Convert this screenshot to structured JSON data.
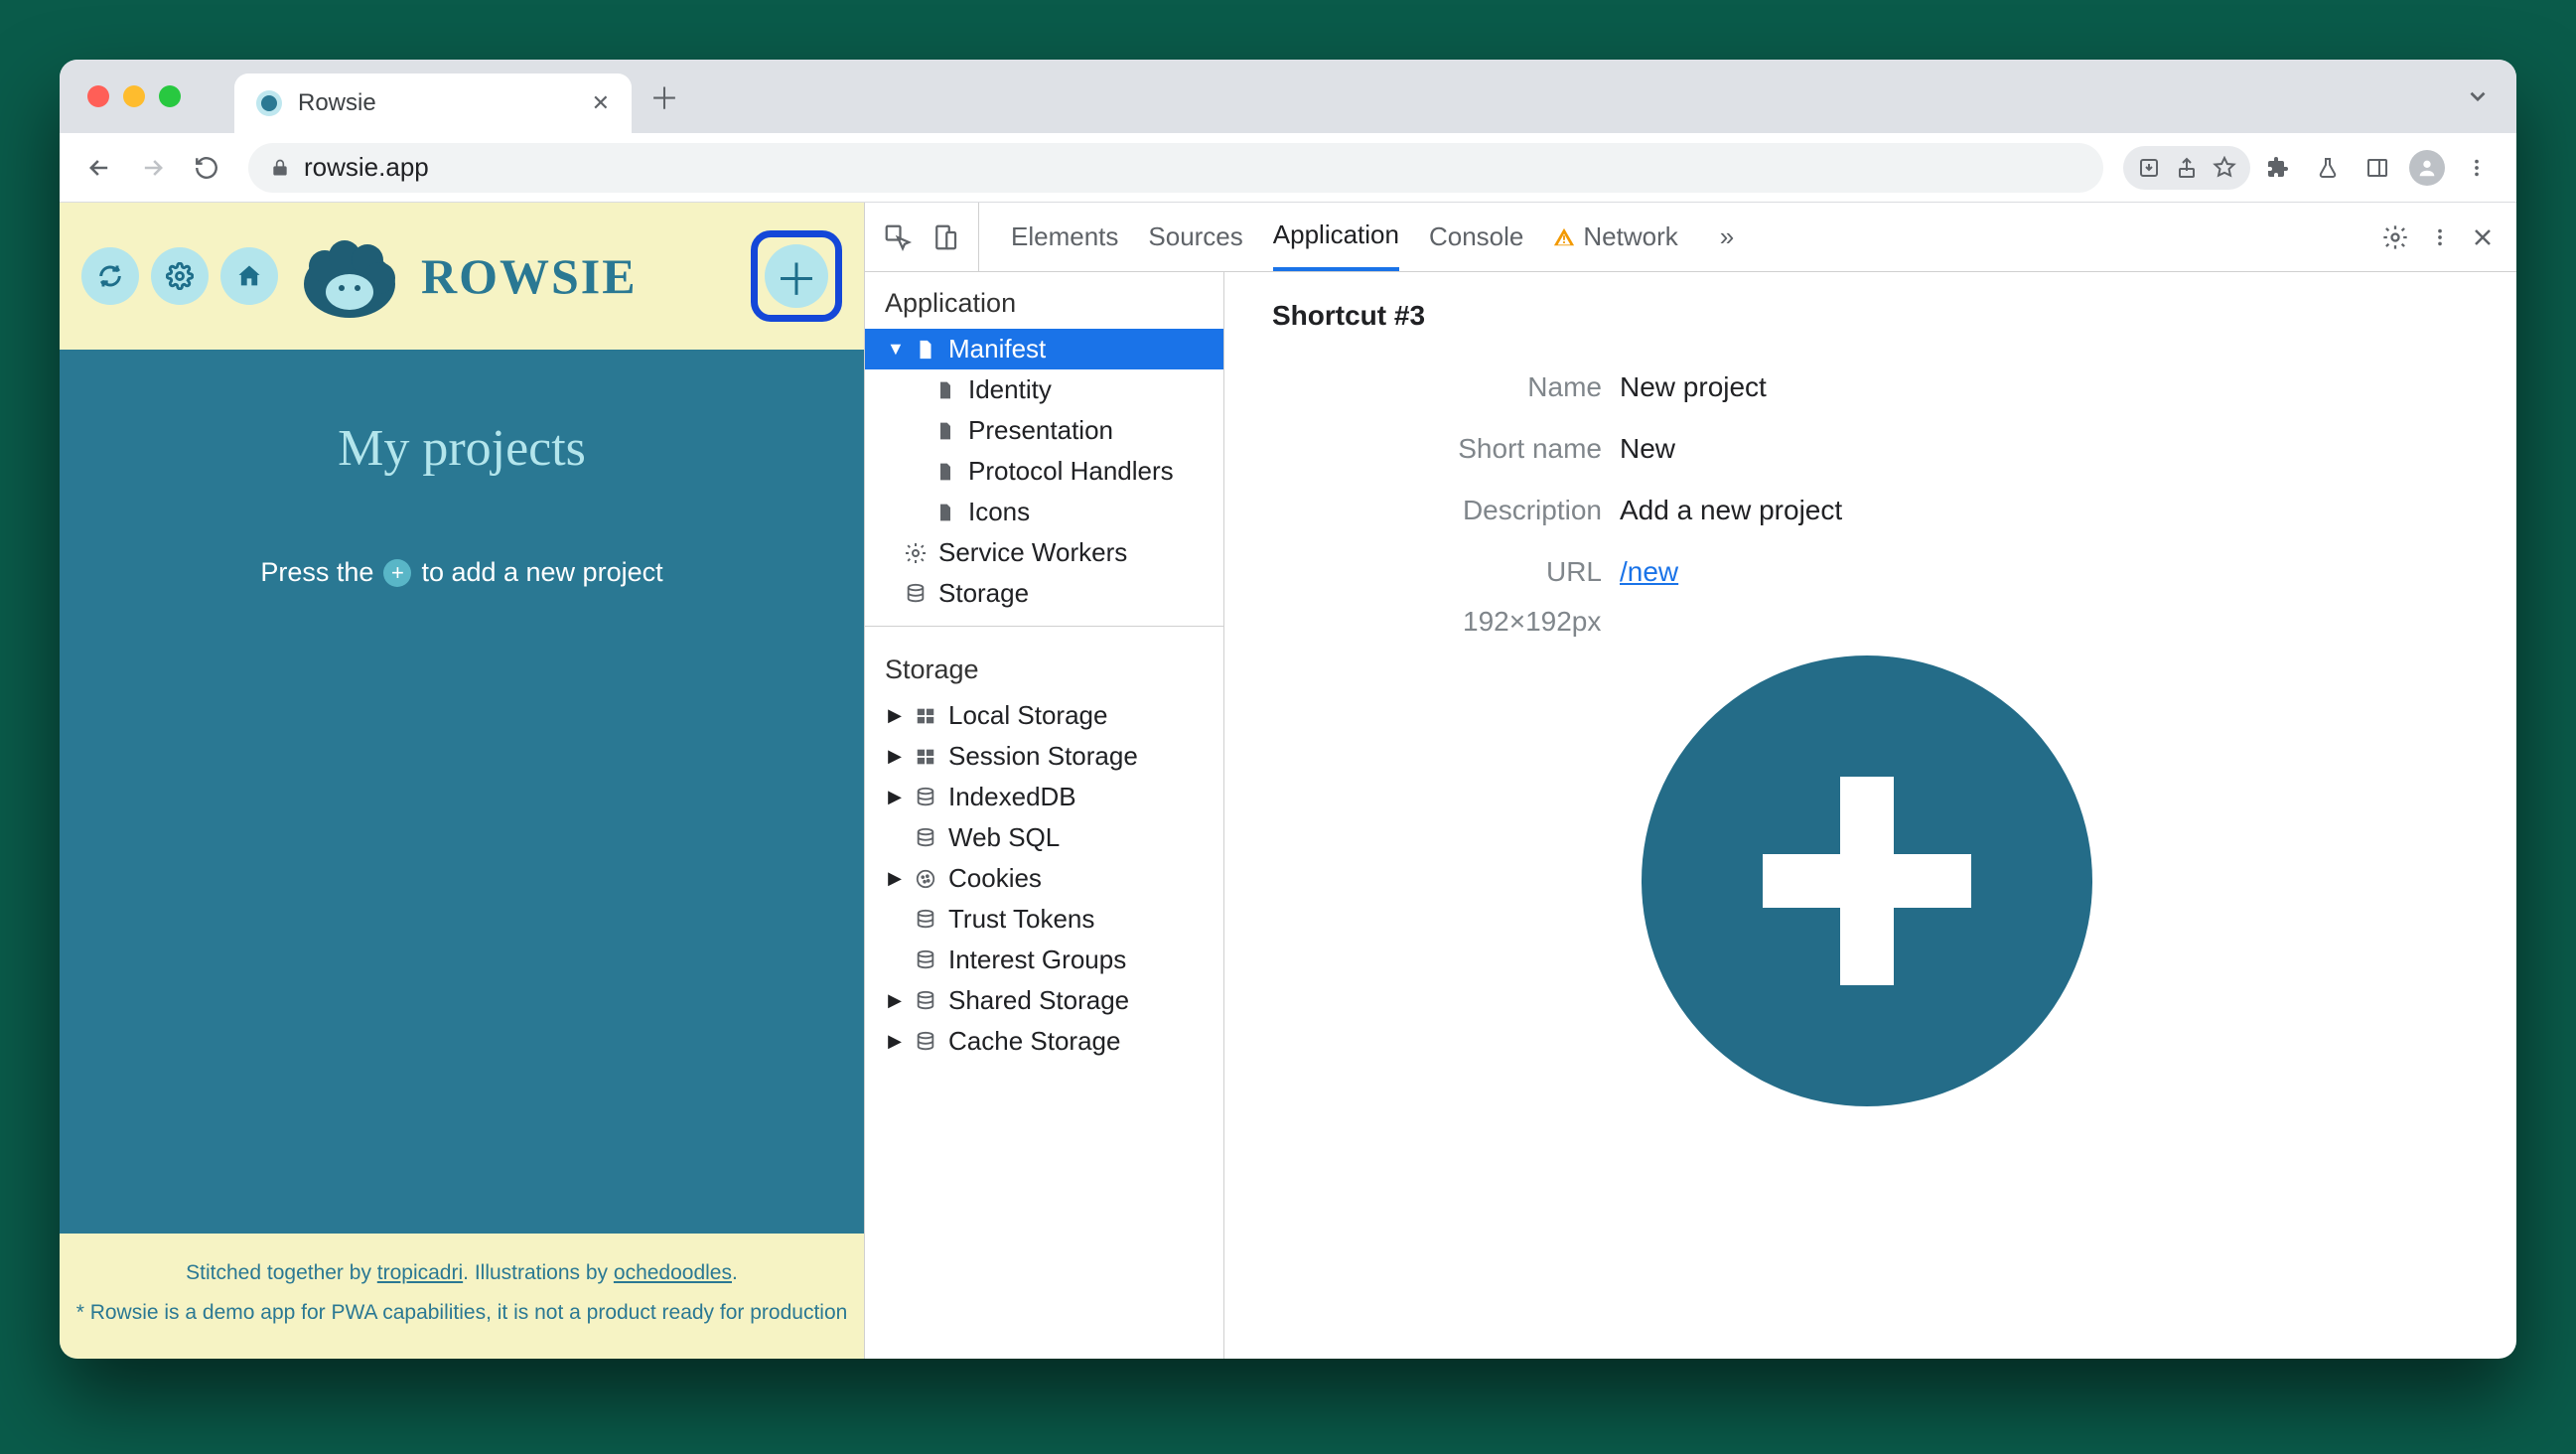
{
  "browser": {
    "tab_title": "Rowsie",
    "url": "rowsie.app"
  },
  "app": {
    "logo_text": "ROWSIE",
    "heading": "My projects",
    "hint_pre": "Press the",
    "hint_post": "to add a new project",
    "footer_line1_pre": "Stitched together by ",
    "footer_link1": "tropicadri",
    "footer_line1_mid": ". Illustrations by ",
    "footer_link2": "ochedoodles",
    "footer_line1_post": ".",
    "footer_line2": "* Rowsie is a demo app for PWA capabilities, it is not a product ready for production"
  },
  "devtools": {
    "tabs": [
      "Elements",
      "Sources",
      "Application",
      "Console",
      "Network"
    ],
    "active_tab": "Application",
    "side": {
      "section1": "Application",
      "manifest": "Manifest",
      "manifest_children": [
        "Identity",
        "Presentation",
        "Protocol Handlers",
        "Icons"
      ],
      "service_workers": "Service Workers",
      "storage_top": "Storage",
      "section2": "Storage",
      "storage_items": [
        "Local Storage",
        "Session Storage",
        "IndexedDB",
        "Web SQL",
        "Cookies",
        "Trust Tokens",
        "Interest Groups",
        "Shared Storage",
        "Cache Storage"
      ],
      "expandable": {
        "Local Storage": true,
        "Session Storage": true,
        "IndexedDB": true,
        "Web SQL": false,
        "Cookies": true,
        "Trust Tokens": false,
        "Interest Groups": false,
        "Shared Storage": true,
        "Cache Storage": true
      }
    },
    "shortcut": {
      "title": "Shortcut #3",
      "fields": {
        "name_k": "Name",
        "name_v": "New project",
        "short_k": "Short name",
        "short_v": "New",
        "desc_k": "Description",
        "desc_v": "Add a new project",
        "url_k": "URL",
        "url_v": "/new"
      },
      "px": "192×192px"
    }
  }
}
